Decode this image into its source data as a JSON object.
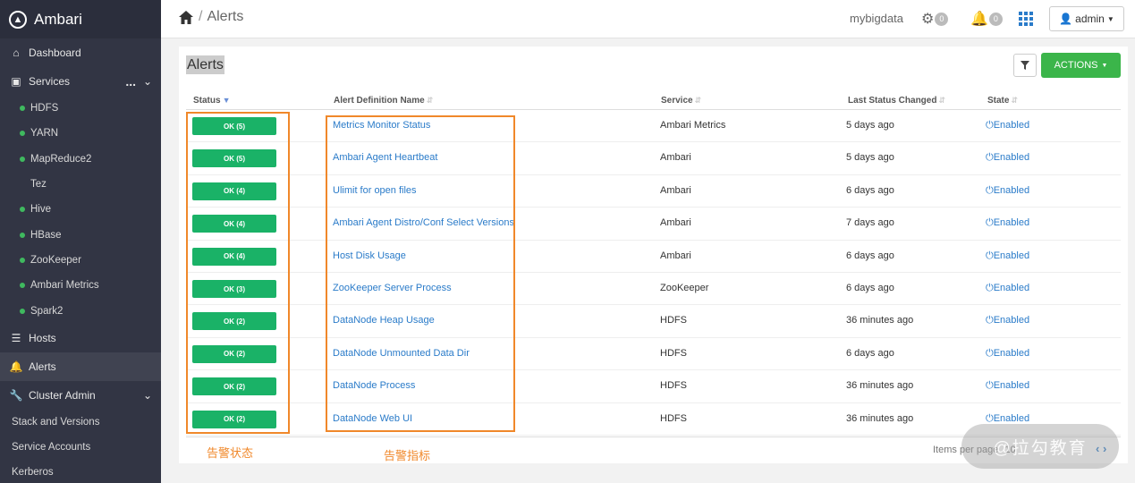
{
  "brand": {
    "name": "Ambari"
  },
  "sidebar": {
    "dashboard": "Dashboard",
    "services": "Services",
    "services_dots": "...",
    "service_items": [
      {
        "label": "HDFS",
        "status": "green"
      },
      {
        "label": "YARN",
        "status": "green"
      },
      {
        "label": "MapReduce2",
        "status": "green"
      },
      {
        "label": "Tez",
        "status": "none"
      },
      {
        "label": "Hive",
        "status": "green"
      },
      {
        "label": "HBase",
        "status": "green"
      },
      {
        "label": "ZooKeeper",
        "status": "green"
      },
      {
        "label": "Ambari Metrics",
        "status": "green"
      },
      {
        "label": "Spark2",
        "status": "green"
      }
    ],
    "hosts": "Hosts",
    "alerts": "Alerts",
    "cluster_admin": "Cluster Admin",
    "admin_items": [
      "Stack and Versions",
      "Service Accounts",
      "Kerberos"
    ]
  },
  "topbar": {
    "breadcrumb_sep": "/",
    "breadcrumb_page": "Alerts",
    "cluster_name": "mybigdata",
    "ops_count": "0",
    "alerts_count": "0",
    "user": "admin"
  },
  "panel": {
    "title": "Alerts",
    "actions_label": "ACTIONS",
    "columns": {
      "status": "Status",
      "definition": "Alert Definition Name",
      "service": "Service",
      "changed": "Last Status Changed",
      "state": "State"
    },
    "rows": [
      {
        "status": "OK (5)",
        "definition": "Metrics Monitor Status",
        "service": "Ambari Metrics",
        "changed": "5 days ago",
        "state": "Enabled"
      },
      {
        "status": "OK (5)",
        "definition": "Ambari Agent Heartbeat",
        "service": "Ambari",
        "changed": "5 days ago",
        "state": "Enabled"
      },
      {
        "status": "OK (4)",
        "definition": "Ulimit for open files",
        "service": "Ambari",
        "changed": "6 days ago",
        "state": "Enabled"
      },
      {
        "status": "OK (4)",
        "definition": "Ambari Agent Distro/Conf Select Versions",
        "service": "Ambari",
        "changed": "7 days ago",
        "state": "Enabled"
      },
      {
        "status": "OK (4)",
        "definition": "Host Disk Usage",
        "service": "Ambari",
        "changed": "6 days ago",
        "state": "Enabled"
      },
      {
        "status": "OK (3)",
        "definition": "ZooKeeper Server Process",
        "service": "ZooKeeper",
        "changed": "6 days ago",
        "state": "Enabled"
      },
      {
        "status": "OK (2)",
        "definition": "DataNode Heap Usage",
        "service": "HDFS",
        "changed": "36 minutes ago",
        "state": "Enabled"
      },
      {
        "status": "OK (2)",
        "definition": "DataNode Unmounted Data Dir",
        "service": "HDFS",
        "changed": "6 days ago",
        "state": "Enabled"
      },
      {
        "status": "OK (2)",
        "definition": "DataNode Process",
        "service": "HDFS",
        "changed": "36 minutes ago",
        "state": "Enabled"
      },
      {
        "status": "OK (2)",
        "definition": "DataNode Web UI",
        "service": "HDFS",
        "changed": "36 minutes ago",
        "state": "Enabled"
      }
    ],
    "pager_label": "Items per page",
    "pager_value": "10"
  },
  "annotations": {
    "status_label": "告警状态",
    "definition_label": "告警指标"
  },
  "watermark": "@拉勾教育",
  "colors": {
    "sidebar_bg": "#323544",
    "ok_green": "#1ab267",
    "actions_green": "#3bb54a",
    "link_blue": "#2a7bc9",
    "annotation_orange": "#f0882a"
  }
}
